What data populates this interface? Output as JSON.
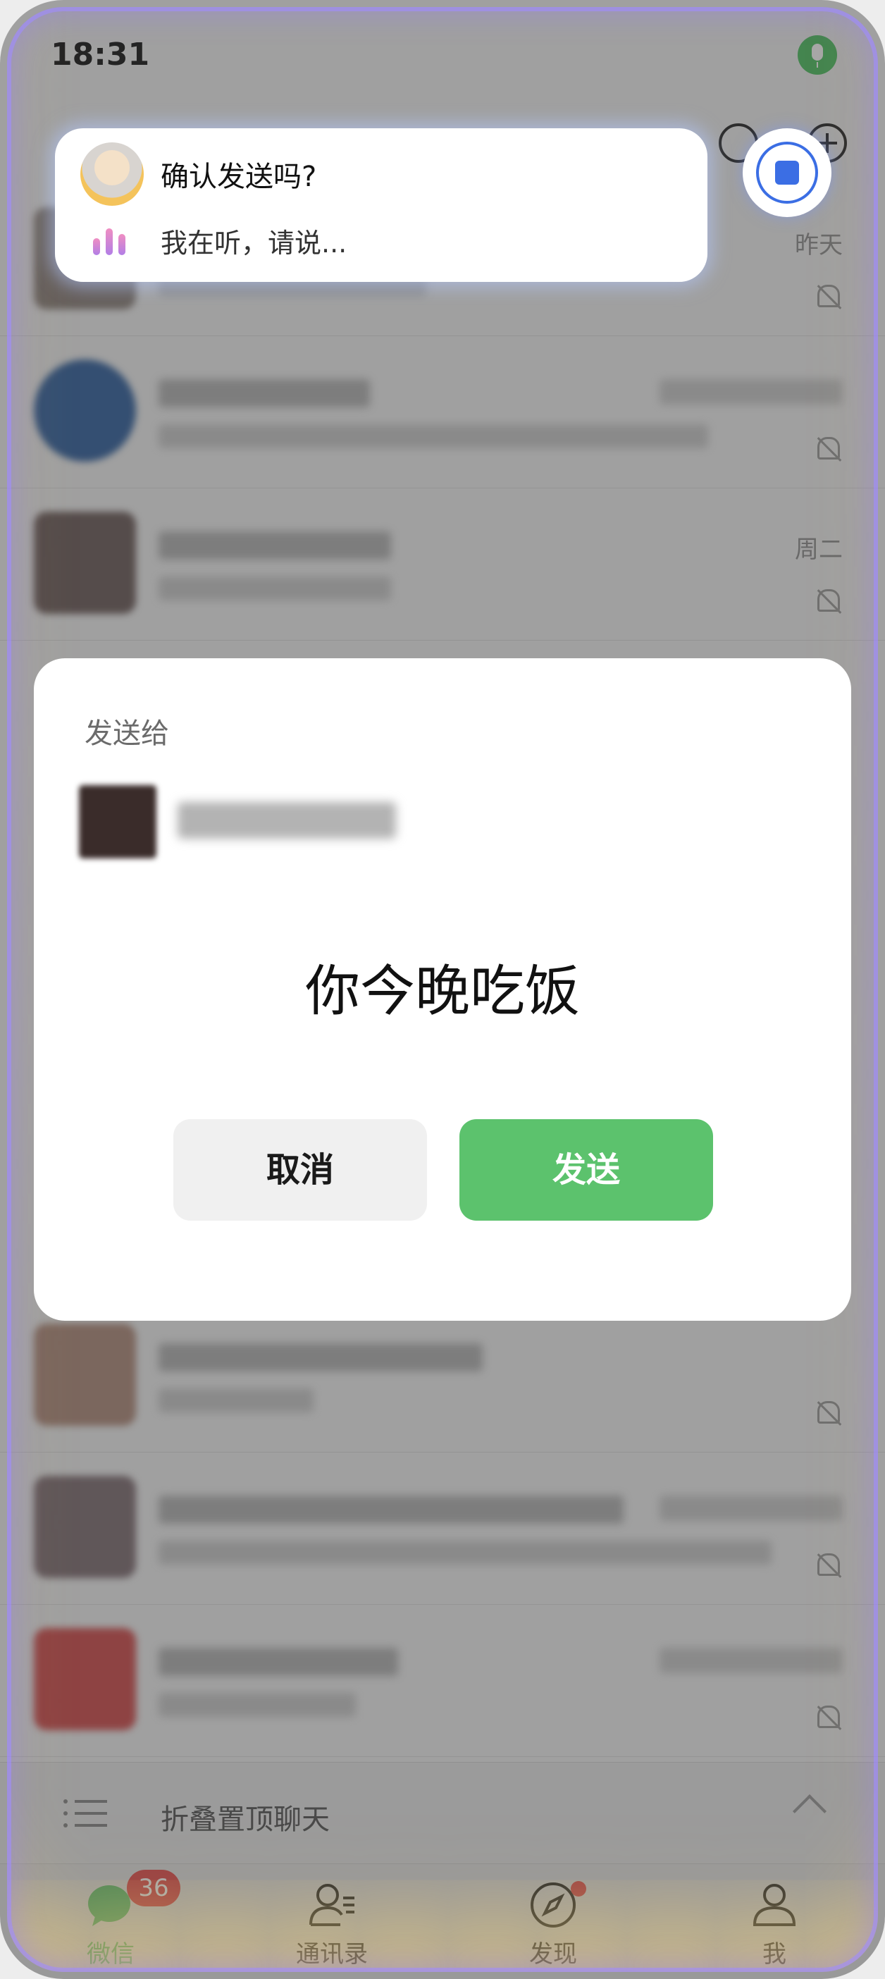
{
  "status_bar": {
    "time": "18:31"
  },
  "chat_list": {
    "rows": [
      {
        "time": "昨天",
        "muted": true
      },
      {
        "time": "",
        "muted": true
      },
      {
        "time": "周二",
        "muted": true
      },
      {
        "time": "",
        "muted": true
      },
      {
        "time": "",
        "muted": true
      },
      {
        "time": "",
        "muted": true
      },
      {
        "time": "",
        "muted": true
      },
      {
        "time": "",
        "muted": true
      }
    ]
  },
  "fold_bar": {
    "label": "折叠置顶聊天"
  },
  "tab_bar": {
    "tabs": [
      {
        "label": "微信",
        "icon": "chat-bubble-icon",
        "badge": "36",
        "active": true
      },
      {
        "label": "通讯录",
        "icon": "contacts-icon",
        "badge": "",
        "active": false
      },
      {
        "label": "发现",
        "icon": "compass-icon",
        "badge": "dot",
        "active": false
      },
      {
        "label": "我",
        "icon": "person-icon",
        "badge": "",
        "active": false
      }
    ]
  },
  "assistant": {
    "question": "确认发送吗?",
    "status": "我在听，请说..."
  },
  "dialog": {
    "title": "发送给",
    "message": "你今晚吃饭",
    "cancel_label": "取消",
    "send_label": "发送"
  },
  "colors": {
    "accent_green": "#5cc26d",
    "badge_red": "#e84a4a",
    "assistant_blue": "#3b6ee4"
  }
}
